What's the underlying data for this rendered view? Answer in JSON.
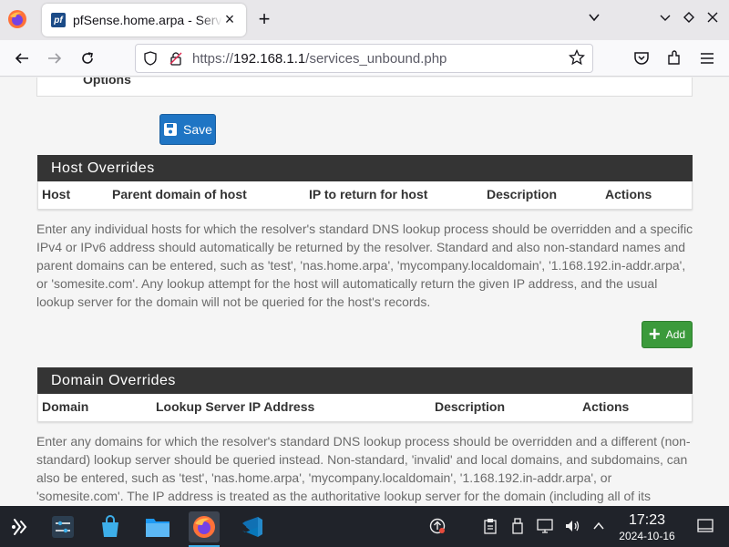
{
  "browser": {
    "tab_title": "pfSense.home.arpa - Servic",
    "tab_favicon": "pf",
    "url_prefix": "https://",
    "url_host": "192.168.1.1",
    "url_path": "/services_unbound.php"
  },
  "options_panel": {
    "label": "Options"
  },
  "save_button": {
    "label": "Save"
  },
  "host_overrides": {
    "title": "Host Overrides",
    "columns": [
      "Host",
      "Parent domain of host",
      "IP to return for host",
      "Description",
      "Actions"
    ],
    "help": "Enter any individual hosts for which the resolver's standard DNS lookup process should be overridden and a specific IPv4 or IPv6 address should automatically be returned by the resolver. Standard and also non-standard names and parent domains can be entered, such as 'test', 'nas.home.arpa', 'mycompany.localdomain', '1.168.192.in-addr.arpa', or 'somesite.com'. Any lookup attempt for the host will automatically return the given IP address, and the usual lookup server for the domain will not be queried for the host's records.",
    "add_label": "Add"
  },
  "domain_overrides": {
    "title": "Domain Overrides",
    "columns": [
      "Domain",
      "Lookup Server IP Address",
      "Description",
      "Actions"
    ],
    "help": "Enter any domains for which the resolver's standard DNS lookup process should be overridden and a different (non-standard) lookup server should be queried instead. Non-standard, 'invalid' and local domains, and subdomains, can also be entered, such as 'test', 'nas.home.arpa', 'mycompany.localdomain', '1.168.192.in-addr.arpa', or 'somesite.com'. The IP address is treated as the authoritative lookup server for the domain (including all of its"
  },
  "taskbar": {
    "time": "17:23",
    "date": "2024-10-16"
  },
  "colors": {
    "panel_header": "#343434",
    "save_button": "#1f75c4",
    "add_button": "#3b9a3b",
    "taskbar": "#20232a"
  }
}
